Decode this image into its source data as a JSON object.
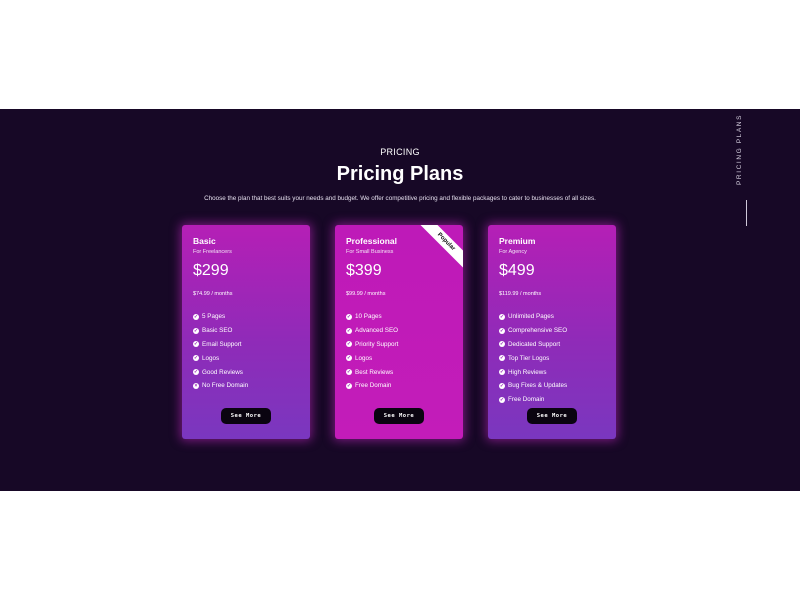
{
  "section": {
    "eyebrow": "PRICING",
    "title": "Pricing Plans",
    "subtitle": "Choose the plan that best suits your needs and budget. We offer competitive pricing and flexible packages to cater to businesses of all sizes.",
    "side_label": "PRICING PLANS"
  },
  "plans": [
    {
      "name": "Basic",
      "audience": "For Freelancers",
      "price": "$299",
      "monthly": "$74.99 / months",
      "features": [
        "5 Pages",
        "Basic SEO",
        "Email Support",
        "Logos",
        "Good Reviews",
        "No Free Domain"
      ],
      "button": "See More"
    },
    {
      "name": "Professional",
      "audience": "For Small Business",
      "price": "$399",
      "monthly": "$99.99 / months",
      "badge": "Popular",
      "features": [
        "10 Pages",
        "Advanced SEO",
        "Priority Support",
        "Logos",
        "Best Reviews",
        "Free Domain"
      ],
      "button": "See More"
    },
    {
      "name": "Premium",
      "audience": "For Agency",
      "price": "$499",
      "monthly": "$119.99 / months",
      "features": [
        "Unlimited Pages",
        "Comprehensive SEO",
        "Dedicated Support",
        "Top Tier Logos",
        "High Reviews",
        "Bug Fixes & Updates",
        "Free Domain"
      ],
      "button": "See More"
    }
  ],
  "colors": {
    "section_bg": "#170826",
    "card_magenta": "#c31cb9",
    "card_purple": "#7a37bf",
    "button_bg": "#0a0410"
  }
}
